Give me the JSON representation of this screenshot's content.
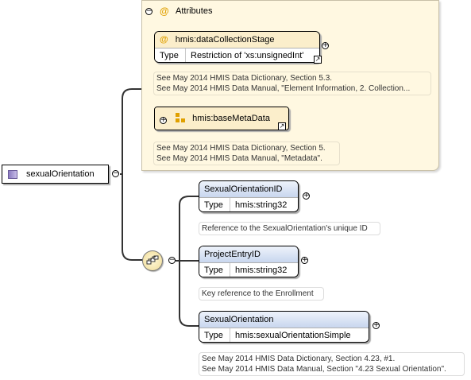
{
  "root": {
    "label": "sexualOrientation"
  },
  "attributes": {
    "title": "Attributes",
    "at_symbol": "@",
    "items": [
      {
        "name": "hmis:dataCollectionStage",
        "type_label": "Type",
        "type_value": "Restriction of 'xs:unsignedInt'",
        "doc": [
          "See May 2014 HMIS Data Dictionary, Section 5.3.",
          "See May 2014 HMIS Data Manual, \"Element Information, 2. Collection..."
        ]
      },
      {
        "name": "hmis:baseMetaData",
        "doc": [
          "See May 2014 HMIS Data Dictionary, Section 5.",
          "See May 2014 HMIS Data Manual, \"Metadata\"."
        ]
      }
    ]
  },
  "elements": [
    {
      "name": "SexualOrientationID",
      "type_label": "Type",
      "type_value": "hmis:string32",
      "doc": [
        "Reference to the SexualOrientation's unique ID"
      ]
    },
    {
      "name": "ProjectEntryID",
      "type_label": "Type",
      "type_value": "hmis:string32",
      "doc": [
        "Key reference to the Enrollment"
      ]
    },
    {
      "name": "SexualOrientation",
      "type_label": "Type",
      "type_value": "hmis:sexualOrientationSimple",
      "doc": [
        "See May 2014 HMIS Data Dictionary, Section 4.23, #1.",
        "See May 2014 HMIS Data Manual, Section \"4.23 Sexual Orientation\"."
      ]
    }
  ],
  "glyphs": {
    "collapse": "−",
    "expand": "+",
    "link": "↗"
  }
}
